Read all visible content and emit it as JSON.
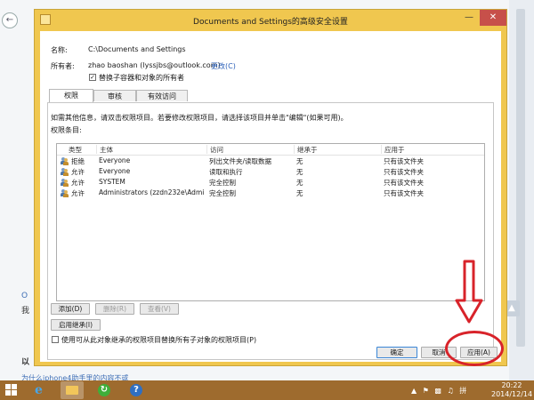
{
  "background": {
    "left_text_1": "O",
    "left_text_2": "我",
    "left_text_3": "以",
    "bottom_link": "为什么iphone4助手里的内容不或"
  },
  "dialog": {
    "title": "Documents and Settings的高级安全设置",
    "name_label": "名称:",
    "name_value": "C:\\Documents and Settings",
    "owner_label": "所有者:",
    "owner_value": "zhao baoshan (lyssjbs@outlook.com)",
    "change_link": "更改(C)",
    "replace_owner_label": "替换子容器和对象的所有者",
    "replace_owner_checked": true,
    "tabs": [
      {
        "label": "权限",
        "active": true
      },
      {
        "label": "审核",
        "active": false
      },
      {
        "label": "有效访问",
        "active": false
      }
    ],
    "info_text": "如需其他信息，请双击权限项目。若要修改权限项目，请选择该项目并单击\"编辑\"(如果可用)。",
    "entries_label": "权限条目:",
    "columns": [
      "类型",
      "主体",
      "访问",
      "继承于",
      "应用于"
    ],
    "rows": [
      {
        "type": "拒绝",
        "principal": "Everyone",
        "access": "列出文件夹/读取数据",
        "inherited": "无",
        "applies": "只有该文件夹"
      },
      {
        "type": "允许",
        "principal": "Everyone",
        "access": "读取和执行",
        "inherited": "无",
        "applies": "只有该文件夹"
      },
      {
        "type": "允许",
        "principal": "SYSTEM",
        "access": "完全控制",
        "inherited": "无",
        "applies": "只有该文件夹"
      },
      {
        "type": "允许",
        "principal": "Administrators (zzdn232e\\Admin...",
        "access": "完全控制",
        "inherited": "无",
        "applies": "只有该文件夹"
      }
    ],
    "add_button": "添加(D)",
    "remove_button": "删除(R)",
    "view_button": "查看(V)",
    "enable_inherit_button": "启用继承(I)",
    "replace_child_label": "使用可从此对象继承的权限项目替换所有子对象的权限项目(P)",
    "replace_child_checked": false,
    "ok_button": "确定",
    "cancel_button": "取消",
    "apply_button": "应用(A)"
  },
  "annotation": {
    "arrow_color": "#d8232a",
    "circle_color": "#d8232a"
  },
  "taskbar": {
    "tray_lang": "拼",
    "time": "20:22",
    "date": "2014/12/14",
    "color": "#9e6b2e"
  }
}
